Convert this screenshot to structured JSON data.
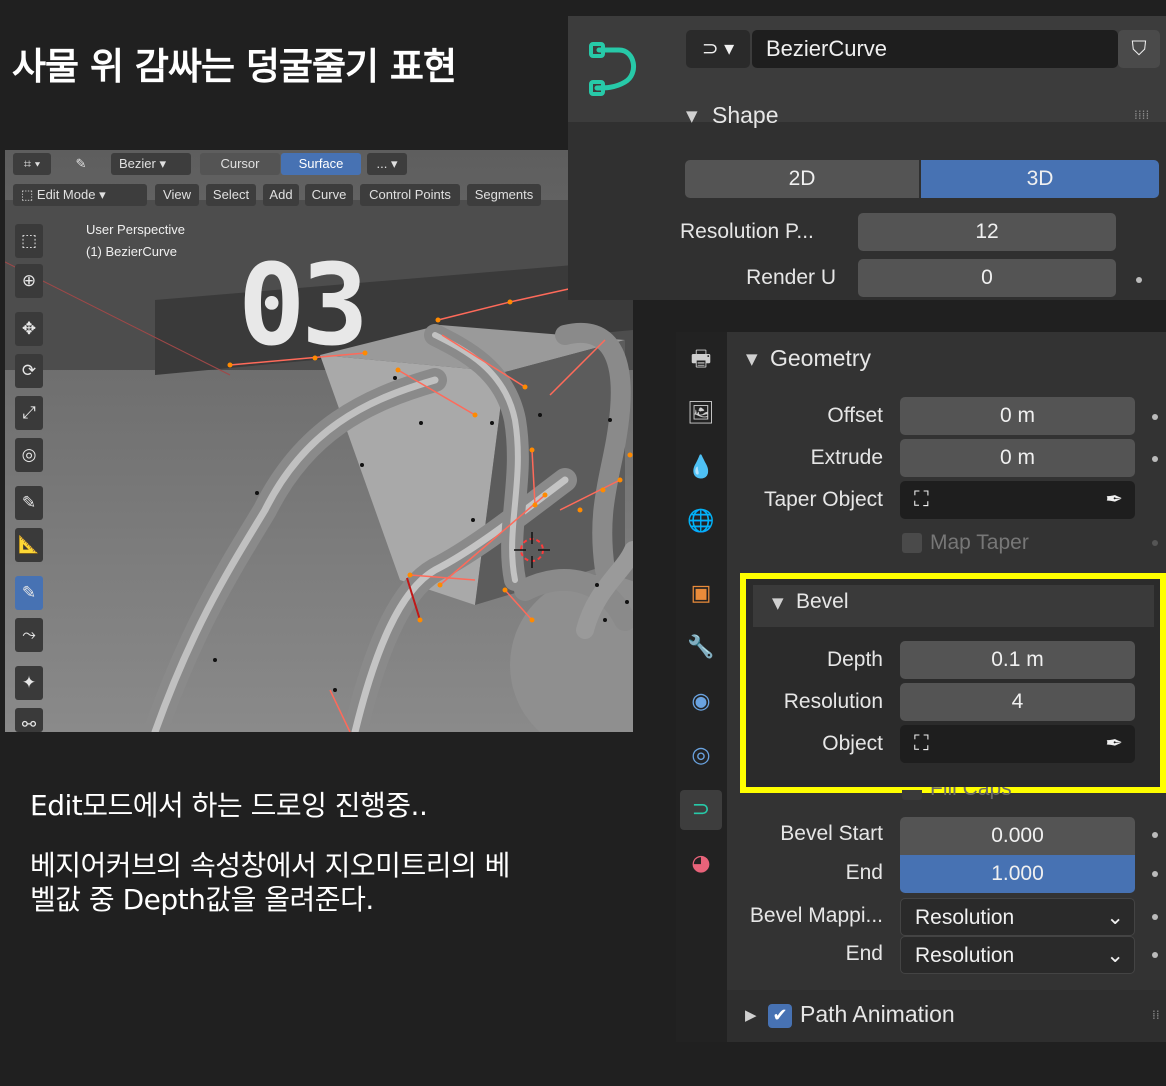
{
  "page_title": "사물 위 감싸는 덩굴줄기 표현",
  "viewport": {
    "header": {
      "curve_type": "Bezier",
      "cursor_label": "Cursor",
      "surface_label": "Surface",
      "more_label": "...",
      "mode": "Edit Mode",
      "menus": [
        "View",
        "Select",
        "Add",
        "Curve",
        "Control Points",
        "Segments"
      ]
    },
    "info_line1": "User Perspective",
    "info_line2": "(1) BezierCurve",
    "step_number": "03"
  },
  "description": {
    "line1": "Edit모드에서 하는 드로잉 진행중..",
    "line2": "베지어커브의 속성창에서  지오미트리의 베",
    "line3": "벨값 중 Depth값을 올려준다."
  },
  "properties": {
    "object_name": "BezierCurve",
    "shape": {
      "header": "Shape",
      "mode_2d": "2D",
      "mode_3d": "3D",
      "active_mode": "3D",
      "resolution_preview_label": "Resolution P...",
      "resolution_preview_value": "12",
      "render_u_label": "Render U",
      "render_u_value": "0"
    },
    "geometry": {
      "header": "Geometry",
      "offset_label": "Offset",
      "offset_value": "0 m",
      "extrude_label": "Extrude",
      "extrude_value": "0 m",
      "taper_label": "Taper Object",
      "map_taper_label": "Map Taper",
      "bevel": {
        "header": "Bevel",
        "depth_label": "Depth",
        "depth_value": "0.1 m",
        "resolution_label": "Resolution",
        "resolution_value": "4",
        "object_label": "Object",
        "fill_caps_label": "Fill Caps"
      },
      "bevel_start_label": "Bevel Start",
      "bevel_start_value": "0.000",
      "end_label": "End",
      "end_value": "1.000",
      "bevel_mapping_label": "Bevel Mappi...",
      "bevel_mapping_value": "Resolution",
      "end_mapping_label": "End",
      "end_mapping_value": "Resolution"
    },
    "path_animation": {
      "header": "Path Animation",
      "checked": true
    }
  },
  "colors": {
    "accent_blue": "#4772b3",
    "highlight_yellow": "#ffff00",
    "curve_icon_green": "#27c9a8"
  }
}
